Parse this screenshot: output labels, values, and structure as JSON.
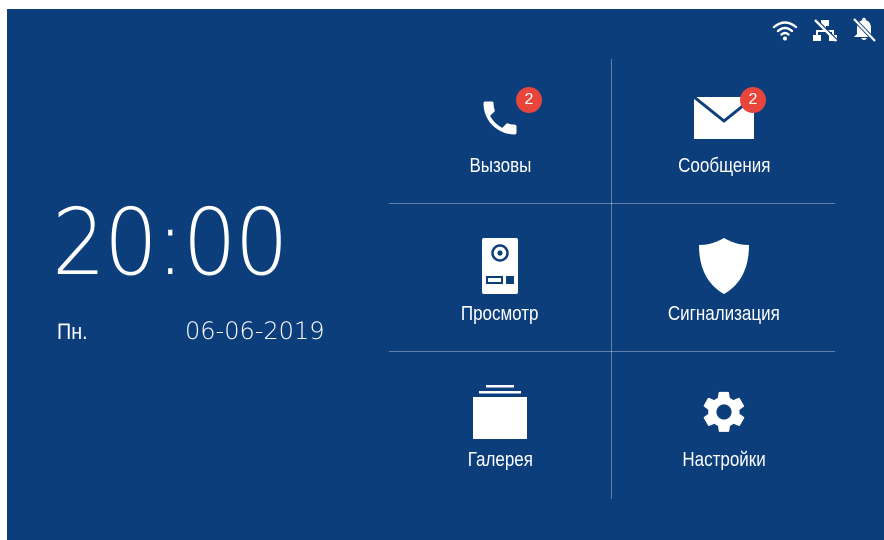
{
  "colors": {
    "background": "#0d3e7c",
    "badge": "#e8453c",
    "foreground": "#ffffff"
  },
  "status_bar": {
    "icons": [
      "wifi-icon",
      "network-disconnected-icon",
      "bell-muted-icon"
    ]
  },
  "clock": {
    "time": "20:00",
    "day": "Пн.",
    "date": "06-06-2019"
  },
  "menu": {
    "calls": {
      "label": "Вызовы",
      "badge": "2",
      "icon": "phone-icon"
    },
    "messages": {
      "label": "Сообщения",
      "badge": "2",
      "icon": "envelope-icon"
    },
    "monitor": {
      "label": "Просмотр",
      "icon": "door-panel-icon"
    },
    "alarm": {
      "label": "Сигнализация",
      "icon": "shield-icon"
    },
    "gallery": {
      "label": "Галерея",
      "icon": "gallery-stack-icon"
    },
    "settings": {
      "label": "Настройки",
      "icon": "gear-icon"
    }
  }
}
